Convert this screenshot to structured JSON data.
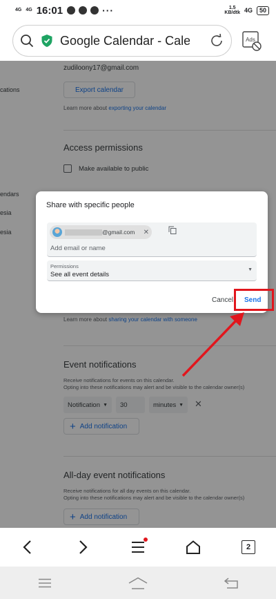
{
  "status_bar": {
    "signal1": "4G",
    "signal2": "4G",
    "time": "16:01",
    "dots": "···",
    "speed": "1.5",
    "speed_unit": "KB/dtk",
    "net": "4G",
    "battery": "50"
  },
  "browser": {
    "url_title": "Google Calendar - Calen…",
    "ads_label": "Ads",
    "tab_count": "2"
  },
  "page": {
    "email": "zudiloony17@gmail.com",
    "export_button": "Export calendar",
    "learn_export_prefix": "Learn more about",
    "learn_export_link": "exporting your calendar",
    "access_heading": "Access permissions",
    "public_checkbox_label": "Make available to public",
    "sidebar": [
      "cations",
      "endars",
      "esia",
      "esia"
    ],
    "learn_share_prefix": "Learn more about",
    "learn_share_link": "sharing your calendar with someone",
    "event_heading": "Event notifications",
    "event_desc1": "Receive notifications for events on this calendar.",
    "event_desc2": "Opting into these notifications may alert and be visible to the calendar owner(s)",
    "notif_type": "Notification",
    "notif_amount": "30",
    "notif_unit": "minutes",
    "add_notification": "Add notification",
    "allday_heading": "All-day event notifications",
    "allday_desc1": "Receive notifications for all day events on this calendar.",
    "allday_desc2": "Opting into these notifications may alert and be visible to the calendar owner(s)",
    "allday_add_notification": "Add notification"
  },
  "dialog": {
    "title": "Share with specific people",
    "chip_email_suffix": "@gmail.com",
    "input_placeholder": "Add email or name",
    "permissions_label": "Permissions",
    "permissions_value": "See all event details",
    "cancel": "Cancel",
    "send": "Send"
  },
  "colors": {
    "accent_blue": "#1a73e8",
    "annotation_red": "#e1161d",
    "shield_green": "#1fa463"
  }
}
